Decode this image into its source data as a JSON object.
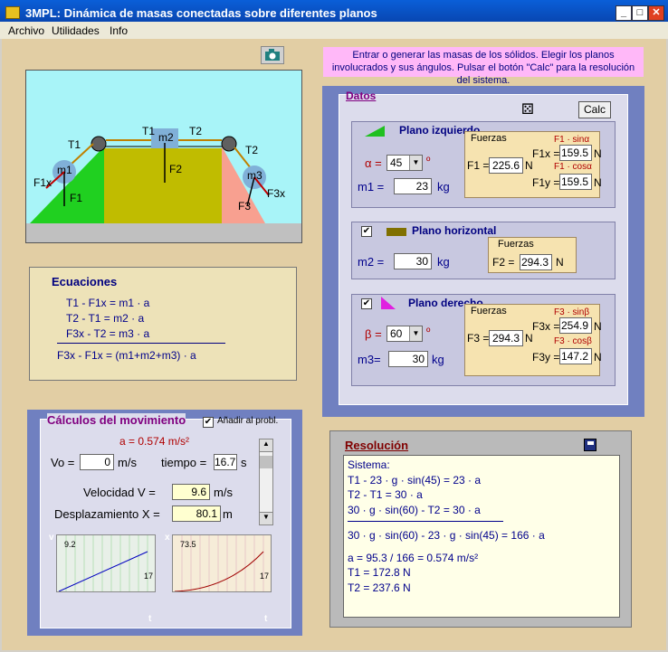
{
  "window": {
    "title": "3MPL: Dinámica de masas conectadas  sobre diferentes planos",
    "min": "_",
    "max": "□",
    "close": "✕"
  },
  "menu": [
    "Archivo",
    "Utilidades",
    "Info"
  ],
  "instructions": "Entrar o generar las masas de los sólidos. Elegir los planos involucrados y sus ángulos. Pulsar el botón  \"Calc\" para  la resolución del sistema.",
  "diagram": {
    "T1a": "T1",
    "T1b": "T1",
    "T2a": "T2",
    "T2b": "T2",
    "m1": "m1",
    "m2": "m2",
    "m3": "m3",
    "F1x": "F1x",
    "F1": "F1",
    "F2": "F2",
    "F3": "F3",
    "F3x": "F3x"
  },
  "ecuaciones": {
    "title": "Ecuaciones",
    "l1": "T1 - F1x  = m1 · a",
    "l2": "T2 - T1  = m2 · a",
    "l3": "F3x - T2  = m3 · a",
    "l4": "F3x - F1x = (m1+m2+m3) · a"
  },
  "datos": {
    "title": "Datos",
    "calc": "Calc",
    "dice": "⚄"
  },
  "left": {
    "title": "Plano izquierdo",
    "alpha_label": "α =",
    "alpha": "45",
    "deg": "º",
    "m1_label": "m1 =",
    "m1": "23",
    "kg": "kg",
    "fuerzas": "Fuerzas",
    "F1_label": "F1 =",
    "F1": "225.6",
    "N": "N",
    "F1x_label": "F1x =",
    "F1x": "159.5",
    "F1y_label": "F1y =",
    "F1y": "159.5",
    "sin": "F1 · sinα",
    "cos": "F1 · cosα"
  },
  "horiz": {
    "title": "Plano horizontal",
    "m2_label": "m2 =",
    "m2": "30",
    "kg": "kg",
    "fuerzas": "Fuerzas",
    "F2_label": "F2 =",
    "F2": "294.3",
    "N": "N"
  },
  "right": {
    "title": "Plano derecho",
    "beta_label": "β =",
    "beta": "60",
    "deg": "º",
    "m3_label": "m3=",
    "m3": "30",
    "kg": "kg",
    "fuerzas": "Fuerzas",
    "F3_label": "F3 =",
    "F3": "294.3",
    "N": "N",
    "F3x_label": "F3x =",
    "F3x": "254.9",
    "F3y_label": "F3y =",
    "F3y": "147.2",
    "sin": "F3 · sinβ",
    "cos": "F3 · cosβ"
  },
  "calculos": {
    "title": "Cálculos del movimiento",
    "add": "Añadir al probl.",
    "accel": "a = 0.574 m/s²",
    "vo_label": "Vo =",
    "vo": "0",
    "ms": "m/s",
    "t_label": "tiempo =",
    "t": "16.7",
    "s": "s",
    "v_label": "Velocidad   V =",
    "v": "9.6",
    "ms2": "m/s",
    "x_label": "Desplazamiento  X =",
    "x": "80.1",
    "m": "m"
  },
  "graph_v": {
    "axis": "v",
    "ymax": "9.2",
    "xmax": "17",
    "t": "t"
  },
  "graph_x": {
    "axis": "x",
    "ymax": "73.5",
    "xmax": "17",
    "t": "t"
  },
  "resolucion": {
    "title": "Resolución",
    "lines": [
      "Sistema:",
      "T1 - 23 · g · sin(45) = 23 · a",
      "T2 - T1 = 30 · a",
      "30 · g · sin(60) - T2 = 30 · a",
      "",
      "30 · g · sin(60) - 23 · g · sin(45) = 166 · a",
      "",
      "a = 95.3 / 166 = 0.574 m/s²",
      "T1 = 172.8 N",
      "T2 = 237.6 N"
    ]
  }
}
